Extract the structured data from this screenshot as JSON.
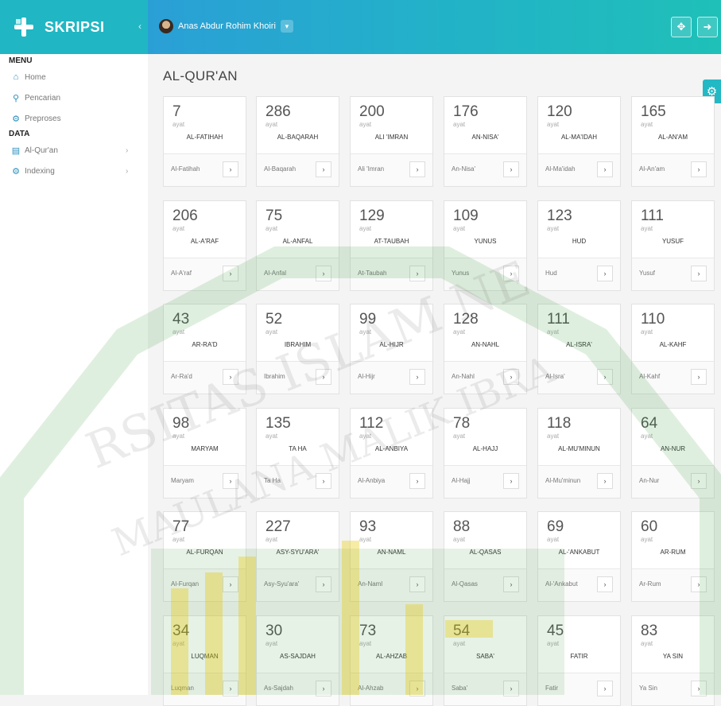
{
  "app": {
    "name": "SKRIPSI",
    "collapse_icon": "chevron-left-icon"
  },
  "header": {
    "user_name": "Anas Abdur Rohim Khoiri",
    "dropdown_icon": "chevron-down-icon",
    "fullscreen_icon": "expand-icon",
    "logout_icon": "logout-icon"
  },
  "sidebar": {
    "menu_title": "MENU",
    "menu_items": [
      {
        "label": "Home",
        "icon": "home-icon"
      },
      {
        "label": "Pencarian",
        "icon": "search-icon"
      },
      {
        "label": "Preproses",
        "icon": "cogs-icon"
      }
    ],
    "data_title": "DATA",
    "data_items": [
      {
        "label": "Al-Qur'an",
        "icon": "book-icon"
      },
      {
        "label": "Indexing",
        "icon": "gear-icon"
      }
    ]
  },
  "page": {
    "title": "AL-QUR'AN",
    "ayat_label": "ayat",
    "settings_icon": "gear-icon"
  },
  "surahs": [
    {
      "count": "7",
      "name": "AL-FATIHAH",
      "latin": "Al-Fatihah"
    },
    {
      "count": "286",
      "name": "AL-BAQARAH",
      "latin": "Al-Baqarah"
    },
    {
      "count": "200",
      "name": "ALI 'IMRAN",
      "latin": "Ali 'Imran"
    },
    {
      "count": "176",
      "name": "AN-NISA'",
      "latin": "An-Nisa'"
    },
    {
      "count": "120",
      "name": "AL-MA'IDAH",
      "latin": "Al-Ma'idah"
    },
    {
      "count": "165",
      "name": "AL-AN'AM",
      "latin": "Al-An'am"
    },
    {
      "count": "206",
      "name": "AL-A'RAF",
      "latin": "Al-A'raf"
    },
    {
      "count": "75",
      "name": "AL-ANFAL",
      "latin": "Al-Anfal"
    },
    {
      "count": "129",
      "name": "AT-TAUBAH",
      "latin": "At-Taubah"
    },
    {
      "count": "109",
      "name": "YUNUS",
      "latin": "Yunus"
    },
    {
      "count": "123",
      "name": "HUD",
      "latin": "Hud"
    },
    {
      "count": "111",
      "name": "YUSUF",
      "latin": "Yusuf"
    },
    {
      "count": "43",
      "name": "AR-RA'D",
      "latin": "Ar-Ra'd"
    },
    {
      "count": "52",
      "name": "IBRAHIM",
      "latin": "Ibrahim"
    },
    {
      "count": "99",
      "name": "AL-HIJR",
      "latin": "Al-Hijr"
    },
    {
      "count": "128",
      "name": "AN-NAHL",
      "latin": "An-Nahl"
    },
    {
      "count": "111",
      "name": "AL-ISRA'",
      "latin": "Al-Isra'"
    },
    {
      "count": "110",
      "name": "AL-KAHF",
      "latin": "Al-Kahf"
    },
    {
      "count": "98",
      "name": "MARYAM",
      "latin": "Maryam"
    },
    {
      "count": "135",
      "name": "TA HA",
      "latin": "Ta Ha"
    },
    {
      "count": "112",
      "name": "AL-ANBIYA",
      "latin": "Al-Anbiya"
    },
    {
      "count": "78",
      "name": "AL-HAJJ",
      "latin": "Al-Hajj"
    },
    {
      "count": "118",
      "name": "AL-MU'MINUN",
      "latin": "Al-Mu'minun"
    },
    {
      "count": "64",
      "name": "AN-NUR",
      "latin": "An-Nur"
    },
    {
      "count": "77",
      "name": "AL-FURQAN",
      "latin": "Al-Furqan"
    },
    {
      "count": "227",
      "name": "ASY-SYU'ARA'",
      "latin": "Asy-Syu'ara'"
    },
    {
      "count": "93",
      "name": "AN-NAML",
      "latin": "An-Naml"
    },
    {
      "count": "88",
      "name": "AL-QASAS",
      "latin": "Al-Qasas"
    },
    {
      "count": "69",
      "name": "AL-'ANKABUT",
      "latin": "Al-'Ankabut"
    },
    {
      "count": "60",
      "name": "AR-RUM",
      "latin": "Ar-Rum"
    },
    {
      "count": "34",
      "name": "LUQMAN",
      "latin": "Luqman"
    },
    {
      "count": "30",
      "name": "AS-SAJDAH",
      "latin": "As-Sajdah"
    },
    {
      "count": "73",
      "name": "AL-AHZAB",
      "latin": "Al-Ahzab"
    },
    {
      "count": "54",
      "name": "SABA'",
      "latin": "Saba'"
    },
    {
      "count": "45",
      "name": "FATIR",
      "latin": "Fatir"
    },
    {
      "count": "83",
      "name": "YA SIN",
      "latin": "Ya Sin"
    }
  ],
  "colors": {
    "accent": "#21b6c3",
    "header_start": "#2a9fd6",
    "header_end": "#1fc0b8",
    "watermark_green": "#3a9a3a",
    "watermark_gold": "#e8c800"
  }
}
